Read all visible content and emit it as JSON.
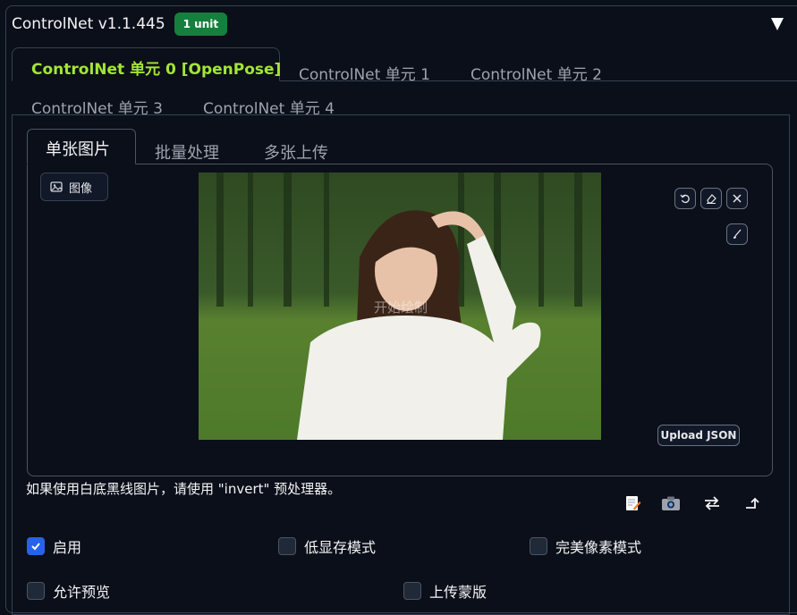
{
  "header": {
    "title": "ControlNet v1.1.445",
    "badge": "1 unit"
  },
  "unit_tabs": [
    {
      "label": "ControlNet 单元 0 [OpenPose]",
      "active": true
    },
    {
      "label": "ControlNet 单元 1"
    },
    {
      "label": "ControlNet 单元 2"
    },
    {
      "label": "ControlNet 单元 3"
    },
    {
      "label": "ControlNet 单元 4"
    }
  ],
  "mode_tabs": [
    {
      "label": "单张图片",
      "active": true
    },
    {
      "label": "批量处理"
    },
    {
      "label": "多张上传"
    }
  ],
  "image_panel": {
    "label": "图像",
    "overlay_text": "开始绘制",
    "upload_json_label": "Upload JSON"
  },
  "hint": "如果使用白底黑线图片，请使用 \"invert\" 预处理器。",
  "options": [
    {
      "label": "启用",
      "checked": true
    },
    {
      "label": "低显存模式",
      "checked": false
    },
    {
      "label": "完美像素模式",
      "checked": false
    },
    {
      "label": "允许预览",
      "checked": false
    },
    {
      "label": "上传蒙版",
      "checked": false
    }
  ],
  "colors": {
    "background": "#0b0f19",
    "active_unit_tab": "#a3e635",
    "badge": "#15803d",
    "checkbox_checked": "#2563eb"
  }
}
